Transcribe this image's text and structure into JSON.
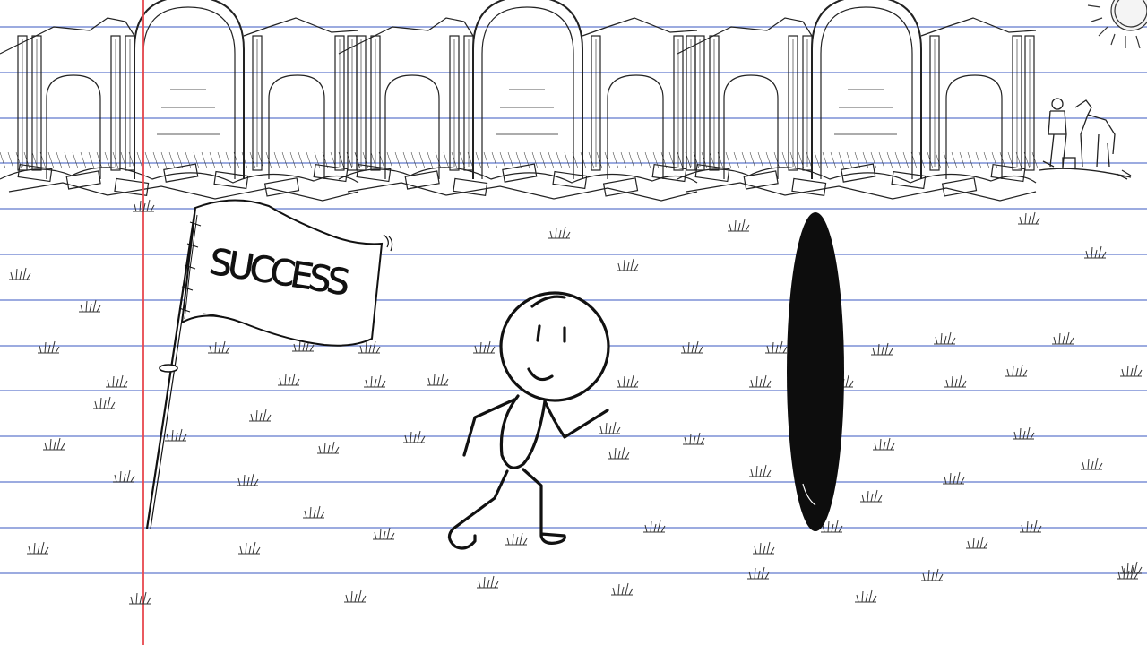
{
  "flag": {
    "text": "SUCCESS"
  },
  "colors": {
    "paper": "#ffffff",
    "rule_line": "#7b8fd6",
    "margin_line": "#e8484f",
    "ink": "#111111"
  },
  "icons": {
    "ruins": "ruins-sketch",
    "sun": "sun-icon",
    "traveler": "traveler-with-horse",
    "flag": "flag-icon",
    "character": "stick-figure",
    "portal": "portal-oval",
    "grass": "grass-tuft-icon"
  }
}
